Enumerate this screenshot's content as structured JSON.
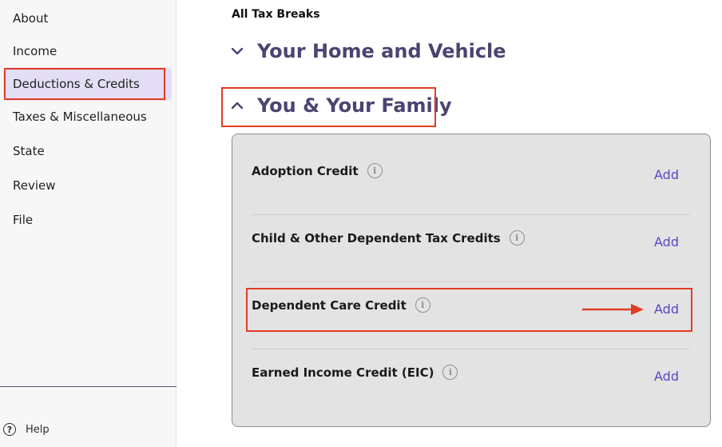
{
  "sidebar": {
    "items": [
      {
        "label": "About"
      },
      {
        "label": "Income"
      },
      {
        "label": "Deductions & Credits"
      },
      {
        "label": "Taxes & Miscellaneous"
      },
      {
        "label": "State"
      },
      {
        "label": "Review"
      },
      {
        "label": "File"
      }
    ],
    "active_item": "Deductions & Credits",
    "help_label": "Help"
  },
  "main": {
    "breadcrumb": "All Tax Breaks",
    "sections": [
      {
        "title": "Your Home and Vehicle",
        "expanded": false
      },
      {
        "title": "You & Your Family",
        "expanded": true
      }
    ],
    "credits": [
      {
        "label": "Adoption Credit",
        "action": "Add"
      },
      {
        "label": "Child & Other Dependent Tax Credits",
        "action": "Add"
      },
      {
        "label": "Dependent Care Credit",
        "action": "Add"
      },
      {
        "label": "Earned Income Credit (EIC)",
        "action": "Add"
      }
    ]
  },
  "colors": {
    "accent": "#5748c6",
    "heading": "#4b4470",
    "highlight": "#e13c25",
    "active_nav_bg": "#e3def5"
  },
  "icons": {
    "expand": "chevron-down-icon",
    "collapse": "chevron-up-icon",
    "info": "info-icon",
    "help": "question-circle-icon",
    "pointer": "arrow-right-icon"
  }
}
